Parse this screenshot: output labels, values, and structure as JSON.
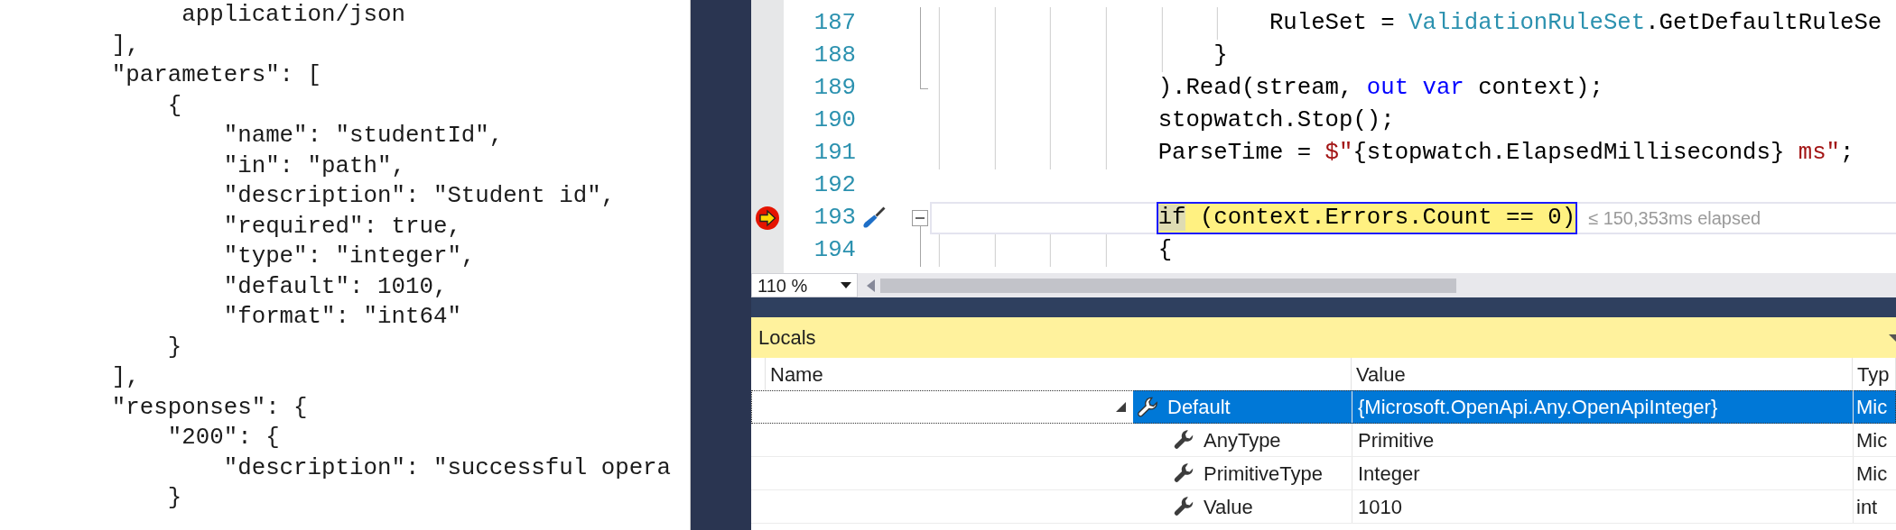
{
  "document": {
    "lines": [
      "             application/json",
      "        ],",
      "        \"parameters\": [",
      "            {",
      "                \"name\": \"studentId\",",
      "                \"in\": \"path\",",
      "                \"description\": \"Student id\",",
      "                \"required\": true,",
      "                \"type\": \"integer\",",
      "                \"default\": 1010,",
      "                \"format\": \"int64\"",
      "            }",
      "        ],",
      "        \"responses\": {",
      "            \"200\": {",
      "                \"description\": \"successful opera",
      "            }"
    ]
  },
  "editor": {
    "lines": [
      {
        "number": "187",
        "current": false,
        "kind": "inside",
        "tokens": [
          {
            "text": "                        RuleSet = ",
            "kind": "plain"
          },
          {
            "text": "ValidationRuleSet",
            "kind": "type"
          },
          {
            "text": ".GetDefaultRuleSe",
            "kind": "plain"
          }
        ]
      },
      {
        "number": "188",
        "current": false,
        "kind": "inside",
        "tokens": [
          {
            "text": "                    }",
            "kind": "plain"
          }
        ]
      },
      {
        "number": "189",
        "current": false,
        "kind": "end",
        "tokens": [
          {
            "text": "                ).Read(stream, ",
            "kind": "plain"
          },
          {
            "text": "out var",
            "kind": "keyword"
          },
          {
            "text": " context);",
            "kind": "plain"
          }
        ]
      },
      {
        "number": "190",
        "current": false,
        "kind": "none",
        "tokens": [
          {
            "text": "                stopwatch.Stop();",
            "kind": "plain"
          }
        ]
      },
      {
        "number": "191",
        "current": false,
        "kind": "none",
        "tokens": [
          {
            "text": "                ParseTime = ",
            "kind": "plain"
          },
          {
            "text": "$\"",
            "kind": "string"
          },
          {
            "text": "{stopwatch.ElapsedMilliseconds}",
            "kind": "plain"
          },
          {
            "text": " ms\"",
            "kind": "string"
          },
          {
            "text": ";",
            "kind": "plain"
          }
        ]
      },
      {
        "number": "192",
        "current": false,
        "kind": "none"
      },
      {
        "number": "193",
        "current": true,
        "kind": "start",
        "tokens": [
          {
            "text": "                if",
            "kind": "keyword"
          },
          {
            "text": " (context.Errors.Count == 0)",
            "kind": "plain"
          }
        ],
        "hint": "≤ 150,353ms elapsed"
      },
      {
        "number": "194",
        "current": false,
        "kind": "inside",
        "tokens": [
          {
            "text": "                {",
            "kind": "plain"
          }
        ]
      }
    ],
    "zoom": "110 %"
  },
  "locals": {
    "title": "Locals",
    "columns": [
      "Name",
      "Value",
      "Typ"
    ],
    "rows": [
      {
        "name": "Default",
        "value": "{Microsoft.OpenApi.Any.OpenApiInteger}",
        "type": "Mic",
        "selected": true,
        "expanded": true,
        "children": [
          {
            "name": "AnyType",
            "value": "Primitive",
            "type": "Mic",
            "selected": false
          },
          {
            "name": "PrimitiveType",
            "value": "Integer",
            "type": "Mic",
            "selected": false
          },
          {
            "name": "Value",
            "value": "1010",
            "type": "int",
            "selected": false
          }
        ]
      }
    ]
  }
}
